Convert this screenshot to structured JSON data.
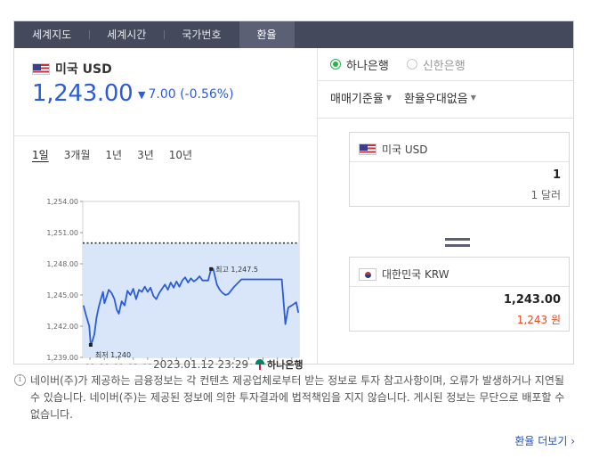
{
  "tabs": [
    "세계지도",
    "세계시간",
    "국가번호",
    "환율"
  ],
  "active_tab": 3,
  "currency": {
    "name": "미국 USD",
    "rate": "1,243.00",
    "change": "7.00 (-0.56%)",
    "change_dir": "down"
  },
  "periods": [
    "1일",
    "3개월",
    "1년",
    "3년",
    "10년"
  ],
  "active_period": 0,
  "chart_data": {
    "type": "line",
    "x_tick_labels": [
      "09",
      "10",
      "11",
      "12",
      "13",
      "14",
      "15",
      "16",
      "17",
      "18",
      "19",
      "20",
      "21",
      "22",
      "23"
    ],
    "y_tick_labels": [
      "1,254.00",
      "1,251.00",
      "1,248.00",
      "1,245.00",
      "1,242.00",
      "1,239.00"
    ],
    "ylim": [
      1239,
      1254
    ],
    "xlim": [
      8.5,
      23.5
    ],
    "reference_line": 1250,
    "series": [
      {
        "x": [
          8.55,
          8.7,
          8.95,
          9.05,
          9.15,
          9.3,
          9.45,
          9.6,
          9.75,
          9.9,
          10.0,
          10.15,
          10.3,
          10.5,
          10.7,
          10.85,
          11.0,
          11.2,
          11.4,
          11.6,
          11.8,
          12.0,
          12.2,
          12.4,
          12.6,
          12.8,
          13.0,
          13.2,
          13.4,
          13.6,
          13.8,
          14.0,
          14.2,
          14.4,
          14.6,
          14.8,
          15.0,
          15.2,
          15.4,
          15.6,
          15.8,
          16.0,
          16.2,
          16.4,
          16.6,
          16.8,
          17.0,
          17.2,
          17.4,
          17.55,
          17.8,
          18.0,
          18.2,
          18.4,
          18.6,
          19.0,
          19.5,
          20.0,
          20.4,
          20.8,
          21.1,
          21.5,
          22.0,
          22.3,
          22.55,
          22.75,
          23.0,
          23.3,
          23.45
        ],
        "y": [
          1244.0,
          1243.2,
          1242.0,
          1240.2,
          1240.5,
          1241.2,
          1242.8,
          1243.8,
          1244.6,
          1245.3,
          1244.2,
          1244.8,
          1245.5,
          1245.2,
          1244.6,
          1243.6,
          1243.2,
          1244.4,
          1244.0,
          1245.4,
          1245.0,
          1245.6,
          1244.6,
          1245.5,
          1245.3,
          1245.8,
          1245.3,
          1245.7,
          1244.9,
          1244.6,
          1245.2,
          1245.6,
          1246.0,
          1245.5,
          1246.2,
          1245.7,
          1246.3,
          1245.8,
          1246.4,
          1246.7,
          1246.2,
          1246.6,
          1246.3,
          1246.5,
          1246.8,
          1246.4,
          1246.4,
          1246.4,
          1247.5,
          1247.5,
          1246.0,
          1245.5,
          1245.2,
          1245.0,
          1245.1,
          1245.8,
          1246.5,
          1246.5,
          1246.5,
          1246.5,
          1246.5,
          1246.5,
          1246.5,
          1246.5,
          1242.2,
          1243.8,
          1244.0,
          1244.3,
          1243.3
        ]
      }
    ],
    "annotations": [
      {
        "label": "최고 1,247.5",
        "x": 17.4,
        "y": 1247.5
      },
      {
        "label": "최저 1,240",
        "x": 9.05,
        "y": 1240.2
      }
    ],
    "grid": false
  },
  "chart_stamp": "2023.01.12 23:29",
  "chart_bank": "하나은행",
  "banks": [
    {
      "label": "하나은행",
      "checked": true
    },
    {
      "label": "신한은행",
      "checked": false
    }
  ],
  "selects": [
    "매매기준율",
    "환율우대없음"
  ],
  "converter": {
    "from": {
      "name": "미국 USD",
      "amount": "1",
      "sub": "1 달러"
    },
    "to": {
      "name": "대한민국 KRW",
      "amount": "1,243.00",
      "sub": "1,243 원"
    }
  },
  "notice": "네이버(주)가 제공하는 금융정보는 각 컨텐츠 제공업체로부터 받는 정보로 투자 참고사항이며, 오류가 발생하거나 지연될 수 있습니다. 네이버(주)는 제공된 정보에 의한 투자결과에 법적책임을 지지 않습니다. 게시된 정보는 무단으로 배포할 수 없습니다.",
  "more_link": "환율 더보기",
  "colors": {
    "accent": "#2b5cd9",
    "tab_bg": "#45495c",
    "line": "#2b5cd9",
    "area": "#d9e6fa",
    "radio_on": "#26b34b",
    "red": "#e04b1f"
  }
}
